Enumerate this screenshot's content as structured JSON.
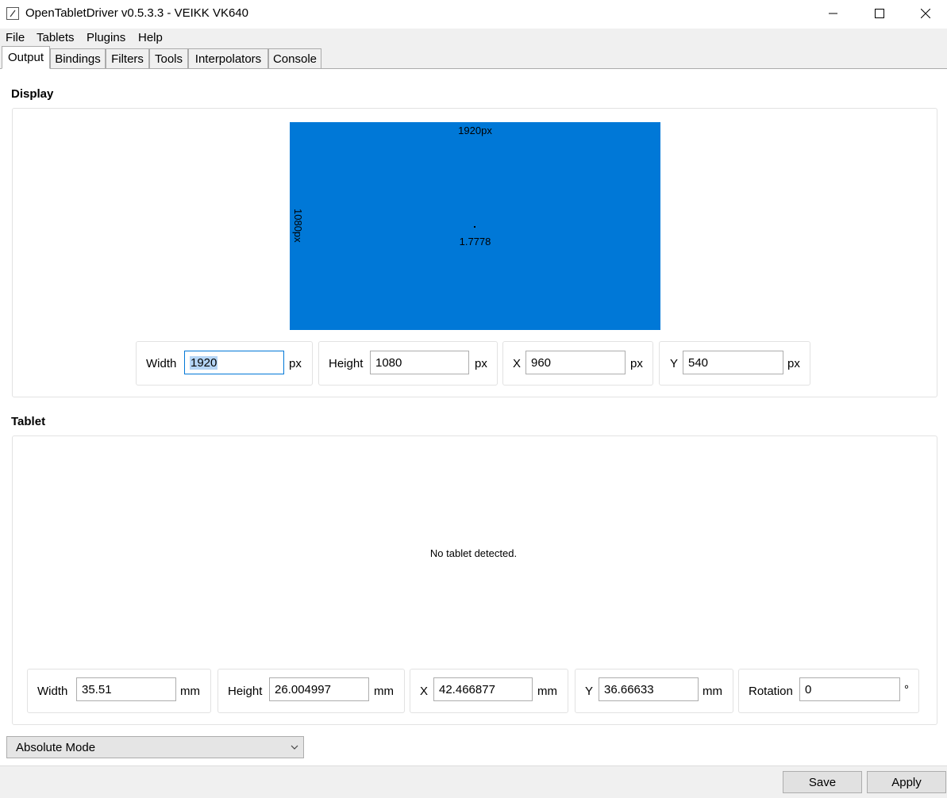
{
  "window": {
    "title": "OpenTabletDriver v0.5.3.3 - VEIKK VK640",
    "controls": {
      "minimize": "minimize-icon",
      "maximize": "maximize-icon",
      "close": "close-icon"
    }
  },
  "menu": [
    "File",
    "Tablets",
    "Plugins",
    "Help"
  ],
  "tabs": [
    {
      "label": "Output",
      "active": true
    },
    {
      "label": "Bindings",
      "active": false
    },
    {
      "label": "Filters",
      "active": false
    },
    {
      "label": "Tools",
      "active": false
    },
    {
      "label": "Interpolators",
      "active": false
    },
    {
      "label": "Console",
      "active": false
    }
  ],
  "display": {
    "section_label": "Display",
    "area_width_label": "1920px",
    "area_height_label": "1080px",
    "aspect_ratio": "1.7778",
    "area_color": "#0078d7",
    "fields": {
      "width": {
        "label": "Width",
        "value": "1920",
        "unit": "px"
      },
      "height": {
        "label": "Height",
        "value": "1080",
        "unit": "px"
      },
      "x": {
        "label": "X",
        "value": "960",
        "unit": "px"
      },
      "y": {
        "label": "Y",
        "value": "540",
        "unit": "px"
      }
    }
  },
  "tablet": {
    "section_label": "Tablet",
    "status": "No tablet detected.",
    "fields": {
      "width": {
        "label": "Width",
        "value": "35.51",
        "unit": "mm"
      },
      "height": {
        "label": "Height",
        "value": "26.004997",
        "unit": "mm"
      },
      "x": {
        "label": "X",
        "value": "42.466877",
        "unit": "mm"
      },
      "y": {
        "label": "Y",
        "value": "36.66633",
        "unit": "mm"
      },
      "rotation": {
        "label": "Rotation",
        "value": "0",
        "unit": "°"
      }
    }
  },
  "mode": {
    "selected": "Absolute Mode"
  },
  "buttons": {
    "save": "Save",
    "apply": "Apply"
  }
}
